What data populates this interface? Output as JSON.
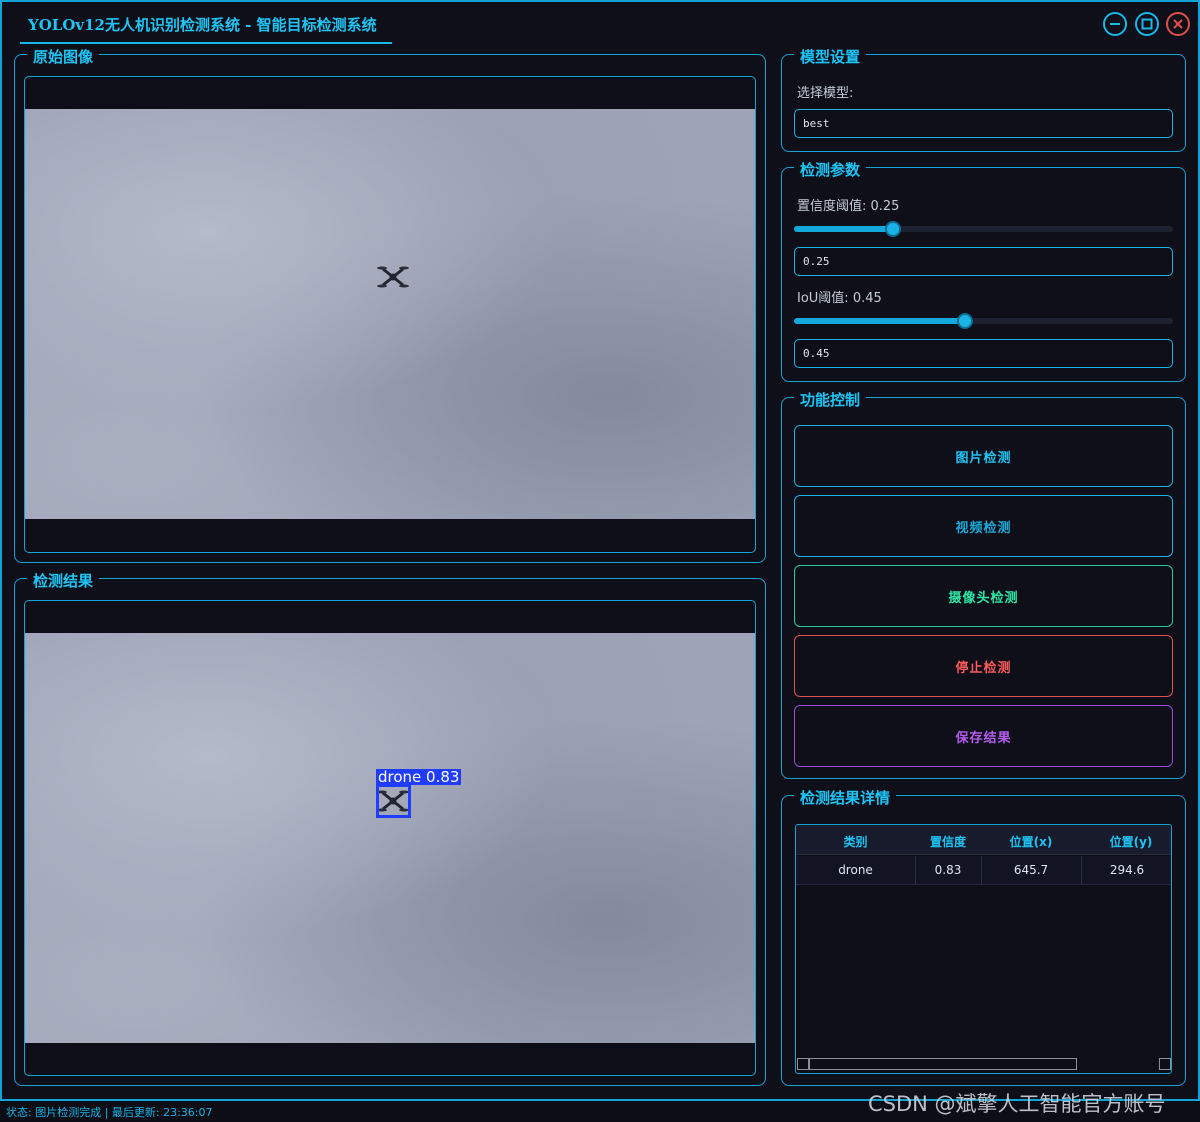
{
  "window": {
    "title": "YOLOv12无人机识别检测系统 - 智能目标检测系统",
    "controls": [
      "minimize-icon",
      "maximize-icon",
      "close-icon"
    ]
  },
  "original_image": {
    "title": "原始图像"
  },
  "result_image": {
    "title": "检测结果",
    "detection_label": "drone 0.83"
  },
  "model_settings": {
    "title": "模型设置",
    "select_label": "选择模型:",
    "selected_model": "best"
  },
  "detection_params": {
    "title": "检测参数",
    "confidence_label": "置信度阈值: 0.25",
    "confidence_value": "0.25",
    "confidence_level": 0.25,
    "iou_label": "IoU阈值: 0.45",
    "iou_value": "0.45",
    "iou_level": 0.45
  },
  "function_control": {
    "title": "功能控制",
    "buttons": {
      "image_detect": "图片检测",
      "video_detect": "视频检测",
      "camera_detect": "摄像头检测",
      "stop_detect": "停止检测",
      "save_result": "保存结果"
    }
  },
  "result_details": {
    "title": "检测结果详情",
    "columns": [
      "类别",
      "置信度",
      "位置(x)",
      "位置(y)"
    ],
    "rows": [
      [
        "drone",
        "0.83",
        "645.7",
        "294.6"
      ]
    ]
  },
  "status_bar": {
    "text": "状态: 图片检测完成 | 最后更新: 23:36:07"
  },
  "watermark": "CSDN @斌擎人工智能官方账号",
  "colors": {
    "accent": "#1ec4f5",
    "camera": "#2ee6a4",
    "stop": "#ff5a5a",
    "save": "#b45cf0",
    "detection_box": "#1f3cff"
  }
}
